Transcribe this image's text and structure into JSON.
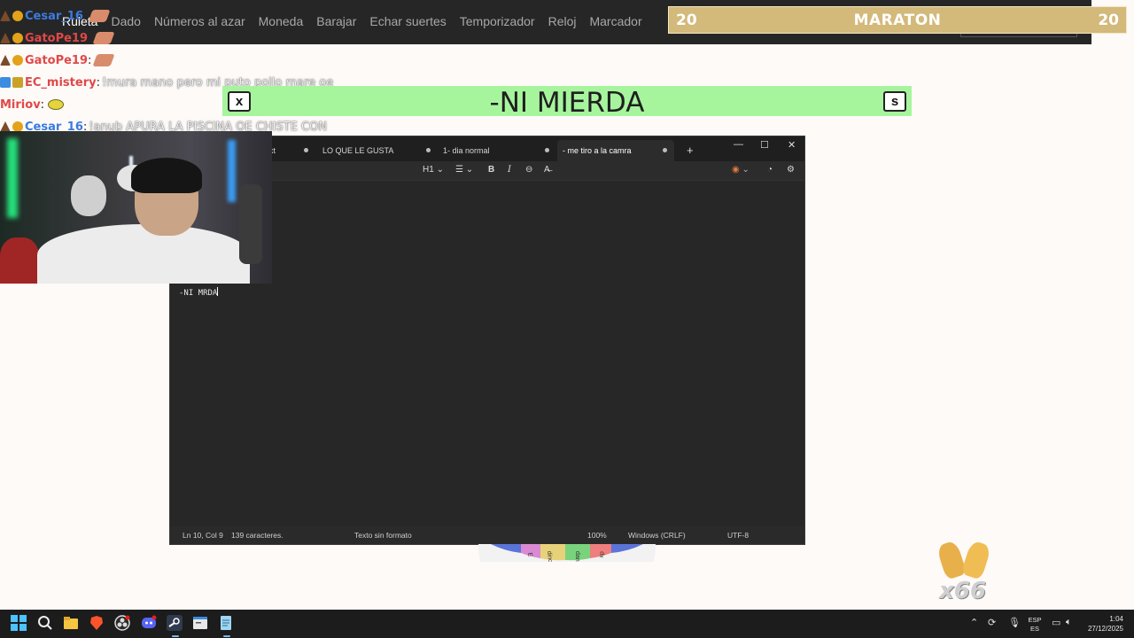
{
  "browser_nav": {
    "items": [
      "Ruleta",
      "Dado",
      "Números al azar",
      "Moneda",
      "Barajar",
      "Echar suertes",
      "Temporizador",
      "Reloj",
      "Marcador"
    ],
    "active": "Ruleta"
  },
  "maraton": {
    "left": "20",
    "title": "MARATON",
    "right": "20"
  },
  "chat": [
    {
      "user": "Cesar_16",
      "color": "#3b7be0",
      "message": "",
      "sticker": "hand"
    },
    {
      "user": "GatoPe19",
      "color": "#e04848",
      "message": "",
      "sticker": "hand"
    },
    {
      "user": "GatoPe19",
      "color": "#e04848",
      "message": "",
      "sticker": "hand"
    },
    {
      "user": "EC_mistery",
      "color": "#e04848",
      "message": "!mura mano pero mi puto pollo mare oe",
      "sticker": ""
    },
    {
      "user": "Miriov",
      "color": "#e04848",
      "message": "",
      "sticker": "lemon"
    },
    {
      "user": "Cesar_16",
      "color": "#3b7be0",
      "message": "!anub APURA LA PISCINA OE CHISTE CON",
      "sticker": ""
    }
  ],
  "subtitle": {
    "text": "-NI MIERDA",
    "close_label": "x",
    "s_label": "s"
  },
  "notepad": {
    "tabs": [
      {
        "label": "xt",
        "modified": true
      },
      {
        "label": "LO QUE LE GUSTA",
        "modified": true
      },
      {
        "label": "1- dia normal",
        "modified": true
      },
      {
        "label": "- me tiro a la camra",
        "modified": true
      }
    ],
    "active_tab": "- me tiro a la camra",
    "toolbar": {
      "heading": "H1"
    },
    "content": "-NI MRDA",
    "status": {
      "position": "Ln 10, Col 9",
      "chars": "139 caracteres.",
      "format": "Texto sin formato",
      "zoom": "100%",
      "line_ending": "Windows (CRLF)",
      "encoding": "UTF-8"
    }
  },
  "wheel": {
    "labels": [
      "E",
      "dino",
      "dani",
      "dx"
    ]
  },
  "clap": {
    "count": "x66"
  },
  "taskbar": {
    "lang_line1": "ESP",
    "lang_line2": "ES",
    "time": "1:04",
    "date": "27/12/2025"
  }
}
